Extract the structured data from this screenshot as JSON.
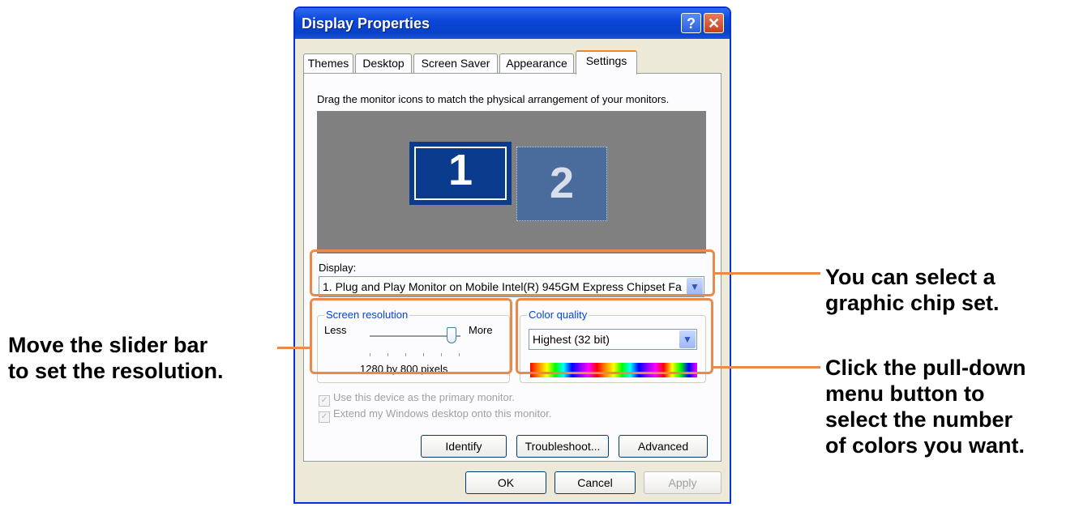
{
  "window": {
    "title": "Display Properties",
    "help_symbol": "?",
    "close_symbol": "✕"
  },
  "tabs": [
    {
      "label": "Themes",
      "active": false
    },
    {
      "label": "Desktop",
      "active": false
    },
    {
      "label": "Screen Saver",
      "active": false
    },
    {
      "label": "Appearance",
      "active": false
    },
    {
      "label": "Settings",
      "active": true
    }
  ],
  "settings": {
    "instruction": "Drag the monitor icons to match the physical arrangement of your monitors.",
    "monitors": [
      "1",
      "2"
    ],
    "display_label": "Display:",
    "display_value": "1. Plug and Play Monitor on Mobile Intel(R) 945GM Express Chipset Fa",
    "resolution": {
      "group_label": "Screen resolution",
      "less_label": "Less",
      "more_label": "More",
      "value_text": "1280 by 800 pixels",
      "slider_fraction": 0.9
    },
    "color_quality": {
      "group_label": "Color quality",
      "value": "Highest (32 bit)"
    },
    "checkboxes": [
      {
        "label": "Use this device as the primary monitor.",
        "checked": true
      },
      {
        "label": "Extend my Windows desktop onto this monitor.",
        "checked": true
      }
    ],
    "buttons": {
      "identify": "Identify",
      "troubleshoot": "Troubleshoot...",
      "advanced": "Advanced"
    }
  },
  "dialog_buttons": {
    "ok": "OK",
    "cancel": "Cancel",
    "apply": "Apply"
  },
  "annotations": {
    "chipset": [
      "You can select a",
      "graphic chip set."
    ],
    "slider": [
      "Move the slider bar",
      "to set the resolution."
    ],
    "colors": [
      "Click the pull-down",
      "menu button to",
      "select the number",
      "of colors you want."
    ]
  },
  "colors": {
    "highlight": "#e78a4c",
    "title_bar": "#0a46d8"
  }
}
